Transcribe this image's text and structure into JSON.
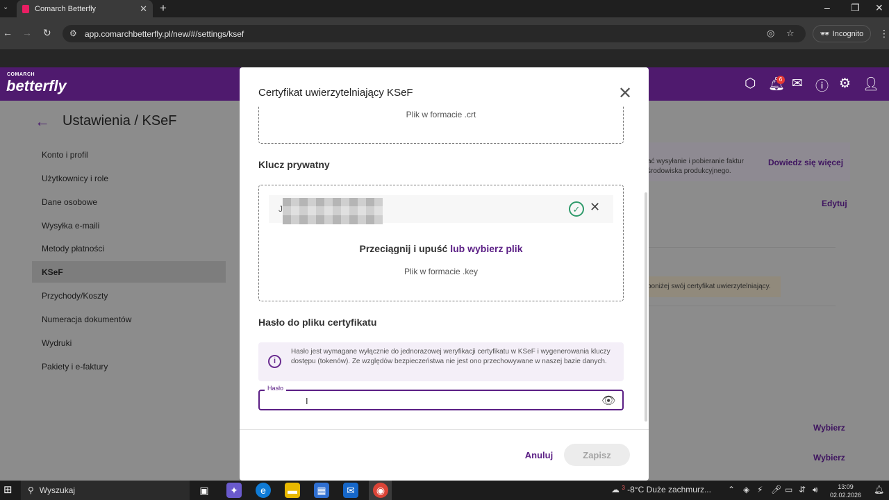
{
  "browser": {
    "tab_title": "Comarch Betterfly",
    "url": "app.comarchbetterfly.pl/new/#/settings/ksef",
    "incognito_label": "Incognito"
  },
  "app": {
    "brand_small": "COMARCH",
    "brand": "betterfly",
    "notification_count": "6",
    "page_title": "Ustawienia / KSeF",
    "sidebar": [
      "Konto i profil",
      "Użytkownicy i role",
      "Dane osobowe",
      "Wysyłka e-maili",
      "Metody płatności",
      "KSeF",
      "Przychody/Koszty",
      "Numeracja dokumentów",
      "Wydruki",
      "Pakiety i e-faktury"
    ],
    "active_sidebar": "KSeF",
    "background": {
      "info_line1": "ać wysyłanie i pobieranie faktur",
      "info_line2": "środowiska produkcyjnego.",
      "learn_more": "Dowiedz się więcej",
      "edit": "Edytuj",
      "warning": "poniżej swój certyfikat uwierzytelniający.",
      "choose1": "Wybierz",
      "choose2": "Wybierz"
    }
  },
  "modal": {
    "title": "Certyfikat uwierzytelniający KSeF",
    "crt_hint": "Plik w formacie .crt",
    "private_key_heading": "Klucz prywatny",
    "file_name_prefix": "J",
    "drag_text": "Przeciągnij i upuść",
    "choose_file_link": "lub wybierz plik",
    "key_hint": "Plik w formacie .key",
    "password_heading": "Hasło do pliku certyfikatu",
    "info_text": "Hasło jest wymagane wyłącznie do jednorazowej weryfikacji certyfikatu w KSeF i wygenerowania kluczy dostępu (tokenów). Ze względów bezpieczeństwa nie jest ono przechowywane w naszej bazie danych.",
    "password_label": "Hasło",
    "password_value": "",
    "cancel_label": "Anuluj",
    "save_label": "Zapisz"
  },
  "taskbar": {
    "search_label": "Wyszukaj",
    "weather_badge": "3",
    "weather": "-8°C  Duże zachmurz...",
    "time": "13:09",
    "date": "02.02.2026"
  }
}
